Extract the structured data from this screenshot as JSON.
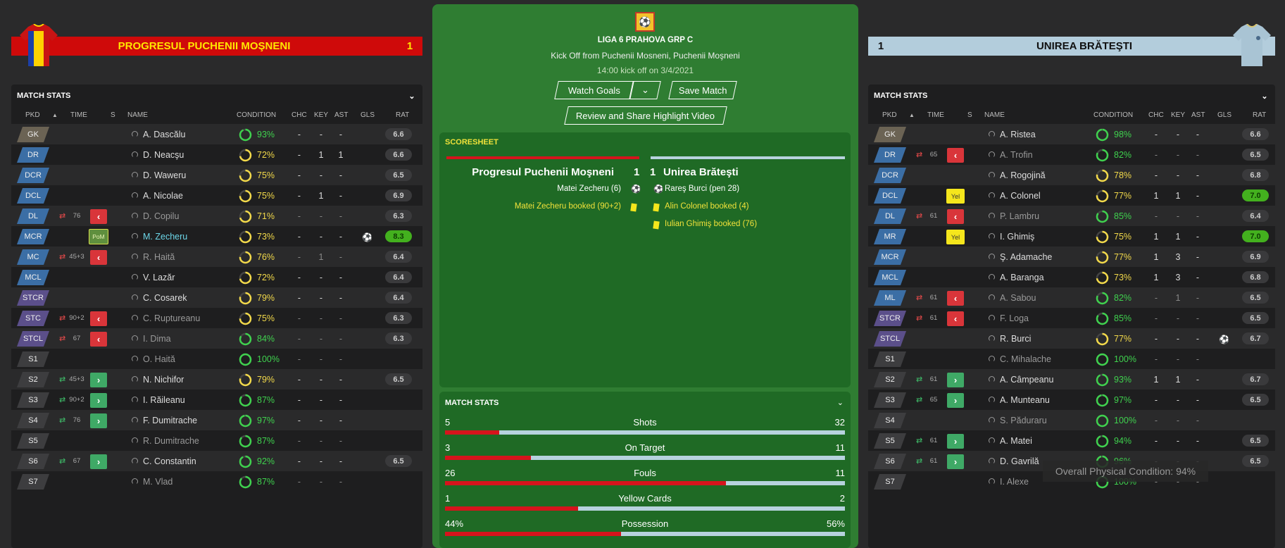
{
  "home": {
    "name": "PROGRESUL PUCHENII MOŞNENI",
    "score": "1",
    "colors": {
      "banner": "#cf0a0a",
      "text": "#ffe600"
    },
    "panel_title": "MATCH STATS",
    "headers": {
      "pkd": "PKD",
      "time": "TIME",
      "s": "S",
      "name": "NAME",
      "condition": "CONDITION",
      "chc": "CHC",
      "key": "KEY",
      "ast": "AST",
      "gls": "GLS",
      "rat": "RAT"
    },
    "players": [
      {
        "pos": "GK",
        "pos_type": "gk",
        "name": "A. Dascălu",
        "cond": "93%",
        "cond_level": 0.93,
        "chc": "-",
        "key": "-",
        "ast": "-",
        "gls": "",
        "rat": "6.6"
      },
      {
        "pos": "DR",
        "pos_type": "def",
        "name": "D. Neacşu",
        "cond": "72%",
        "cond_level": 0.72,
        "chc": "-",
        "key": "1",
        "ast": "1",
        "gls": "",
        "rat": "6.6"
      },
      {
        "pos": "DCR",
        "pos_type": "def",
        "name": "D. Waweru",
        "cond": "75%",
        "cond_level": 0.75,
        "chc": "-",
        "key": "-",
        "ast": "-",
        "gls": "",
        "rat": "6.5"
      },
      {
        "pos": "DCL",
        "pos_type": "def",
        "name": "A. Nicolae",
        "cond": "75%",
        "cond_level": 0.75,
        "chc": "-",
        "key": "1",
        "ast": "-",
        "gls": "",
        "rat": "6.9"
      },
      {
        "pos": "DL",
        "pos_type": "def",
        "swap": "out",
        "time": "76",
        "arrow": "out",
        "name": "D. Copilu",
        "dim": true,
        "cond": "71%",
        "cond_level": 0.71,
        "chc": "-",
        "key": "-",
        "ast": "-",
        "gls": "",
        "rat": "6.3"
      },
      {
        "pos": "MCR",
        "pos_type": "def",
        "badge": "PoM",
        "name": "M. Zecheru",
        "hl": true,
        "cond": "73%",
        "cond_level": 0.73,
        "chc": "-",
        "key": "-",
        "ast": "-",
        "gls": "ball",
        "rat": "8.3",
        "best": true
      },
      {
        "pos": "MC",
        "pos_type": "def",
        "swap": "out",
        "time": "45+3",
        "arrow": "out",
        "name": "R. Haită",
        "dim": true,
        "cond": "76%",
        "cond_level": 0.76,
        "chc": "-",
        "key": "1",
        "ast": "-",
        "gls": "",
        "rat": "6.4"
      },
      {
        "pos": "MCL",
        "pos_type": "def",
        "name": "V. Lazăr",
        "cond": "72%",
        "cond_level": 0.72,
        "chc": "-",
        "key": "-",
        "ast": "-",
        "gls": "",
        "rat": "6.4"
      },
      {
        "pos": "STCR",
        "pos_type": "fw",
        "name": "C. Cosarek",
        "cond": "79%",
        "cond_level": 0.79,
        "chc": "-",
        "key": "-",
        "ast": "-",
        "gls": "",
        "rat": "6.4"
      },
      {
        "pos": "STC",
        "pos_type": "fw",
        "swap": "out",
        "time": "90+2",
        "arrow": "out",
        "name": "C. Ruptureanu",
        "dim": true,
        "cond": "75%",
        "cond_level": 0.75,
        "chc": "-",
        "key": "-",
        "ast": "-",
        "gls": "",
        "rat": "6.3"
      },
      {
        "pos": "STCL",
        "pos_type": "fw",
        "swap": "out",
        "time": "67",
        "arrow": "out",
        "name": "I. Dima",
        "dim": true,
        "cond": "84%",
        "cond_level": 0.84,
        "chc": "-",
        "key": "-",
        "ast": "-",
        "gls": "",
        "rat": "6.3"
      },
      {
        "pos": "S1",
        "pos_type": "sub",
        "name": "O. Haită",
        "dim": true,
        "cond": "100%",
        "cond_level": 1.0,
        "chc": "-",
        "key": "-",
        "ast": "-",
        "gls": "",
        "rat": ""
      },
      {
        "pos": "S2",
        "pos_type": "sub",
        "swap": "in",
        "time": "45+3",
        "arrow": "in",
        "name": "N. Nichifor",
        "cond": "79%",
        "cond_level": 0.79,
        "chc": "-",
        "key": "-",
        "ast": "-",
        "gls": "",
        "rat": "6.5"
      },
      {
        "pos": "S3",
        "pos_type": "sub",
        "swap": "in",
        "time": "90+2",
        "arrow": "in",
        "name": "I. Răileanu",
        "cond": "87%",
        "cond_level": 0.87,
        "chc": "-",
        "key": "-",
        "ast": "-",
        "gls": "",
        "rat": ""
      },
      {
        "pos": "S4",
        "pos_type": "sub",
        "swap": "in",
        "time": "76",
        "arrow": "in",
        "name": "F. Dumitrache",
        "cond": "97%",
        "cond_level": 0.97,
        "chc": "-",
        "key": "-",
        "ast": "-",
        "gls": "",
        "rat": ""
      },
      {
        "pos": "S5",
        "pos_type": "sub",
        "name": "R. Dumitrache",
        "dim": true,
        "cond": "87%",
        "cond_level": 0.87,
        "chc": "-",
        "key": "-",
        "ast": "-",
        "gls": "",
        "rat": ""
      },
      {
        "pos": "S6",
        "pos_type": "sub",
        "swap": "in",
        "time": "67",
        "arrow": "in",
        "name": "C. Constantin",
        "cond": "92%",
        "cond_level": 0.92,
        "chc": "-",
        "key": "-",
        "ast": "-",
        "gls": "",
        "rat": "6.5"
      },
      {
        "pos": "S7",
        "pos_type": "sub",
        "name": "M. Vlad",
        "dim": true,
        "cond": "87%",
        "cond_level": 0.87,
        "chc": "-",
        "key": "-",
        "ast": "-",
        "gls": "",
        "rat": ""
      }
    ]
  },
  "away": {
    "name": "UNIREA BRĂTEŞTI",
    "score": "1",
    "colors": {
      "banner": "#b3cddc",
      "text": "#111111"
    },
    "panel_title": "MATCH STATS",
    "headers": {
      "pkd": "PKD",
      "time": "TIME",
      "s": "S",
      "name": "NAME",
      "condition": "CONDITION",
      "chc": "CHC",
      "key": "KEY",
      "ast": "AST",
      "gls": "GLS",
      "rat": "RAT"
    },
    "players": [
      {
        "pos": "GK",
        "pos_type": "gk",
        "name": "A. Ristea",
        "cond": "98%",
        "cond_level": 0.98,
        "chc": "-",
        "key": "-",
        "ast": "-",
        "gls": "",
        "rat": "6.6"
      },
      {
        "pos": "DR",
        "pos_type": "def",
        "swap": "out",
        "time": "65",
        "arrow": "out",
        "name": "A. Trofin",
        "dim": true,
        "cond": "82%",
        "cond_level": 0.82,
        "chc": "-",
        "key": "-",
        "ast": "-",
        "gls": "",
        "rat": "6.5"
      },
      {
        "pos": "DCR",
        "pos_type": "def",
        "name": "A. Rogojină",
        "cond": "78%",
        "cond_level": 0.78,
        "chc": "-",
        "key": "-",
        "ast": "-",
        "gls": "",
        "rat": "6.8"
      },
      {
        "pos": "DCL",
        "pos_type": "def",
        "badge": "Yel",
        "name": "A. Colonel",
        "cond": "77%",
        "cond_level": 0.77,
        "chc": "1",
        "key": "1",
        "ast": "-",
        "gls": "",
        "rat": "7.0",
        "best": true
      },
      {
        "pos": "DL",
        "pos_type": "def",
        "swap": "out",
        "time": "61",
        "arrow": "out",
        "name": "P. Lambru",
        "dim": true,
        "cond": "85%",
        "cond_level": 0.85,
        "chc": "-",
        "key": "-",
        "ast": "-",
        "gls": "",
        "rat": "6.4"
      },
      {
        "pos": "MR",
        "pos_type": "def",
        "badge": "Yel",
        "name": "I. Ghimiş",
        "cond": "75%",
        "cond_level": 0.75,
        "chc": "1",
        "key": "1",
        "ast": "-",
        "gls": "",
        "rat": "7.0",
        "best": true
      },
      {
        "pos": "MCR",
        "pos_type": "def",
        "name": "Ş. Adamache",
        "cond": "77%",
        "cond_level": 0.77,
        "chc": "1",
        "key": "3",
        "ast": "-",
        "gls": "",
        "rat": "6.9"
      },
      {
        "pos": "MCL",
        "pos_type": "def",
        "name": "A. Baranga",
        "cond": "73%",
        "cond_level": 0.73,
        "chc": "1",
        "key": "3",
        "ast": "-",
        "gls": "",
        "rat": "6.8"
      },
      {
        "pos": "ML",
        "pos_type": "def",
        "swap": "out",
        "time": "61",
        "arrow": "out",
        "name": "A. Sabou",
        "dim": true,
        "cond": "82%",
        "cond_level": 0.82,
        "chc": "-",
        "key": "1",
        "ast": "-",
        "gls": "",
        "rat": "6.5"
      },
      {
        "pos": "STCR",
        "pos_type": "fw",
        "swap": "out",
        "time": "61",
        "arrow": "out",
        "name": "F. Loga",
        "dim": true,
        "cond": "85%",
        "cond_level": 0.85,
        "chc": "-",
        "key": "-",
        "ast": "-",
        "gls": "",
        "rat": "6.5"
      },
      {
        "pos": "STCL",
        "pos_type": "fw",
        "name": "R. Burci",
        "cond": "77%",
        "cond_level": 0.77,
        "chc": "-",
        "key": "-",
        "ast": "-",
        "gls": "ball",
        "rat": "6.7"
      },
      {
        "pos": "S1",
        "pos_type": "sub",
        "name": "C. Mihalache",
        "dim": true,
        "cond": "100%",
        "cond_level": 1.0,
        "chc": "-",
        "key": "-",
        "ast": "-",
        "gls": "",
        "rat": ""
      },
      {
        "pos": "S2",
        "pos_type": "sub",
        "swap": "in",
        "time": "61",
        "arrow": "in",
        "name": "A. Câmpeanu",
        "cond": "93%",
        "cond_level": 0.93,
        "chc": "1",
        "key": "1",
        "ast": "-",
        "gls": "",
        "rat": "6.7"
      },
      {
        "pos": "S3",
        "pos_type": "sub",
        "swap": "in",
        "time": "65",
        "arrow": "in",
        "name": "A. Munteanu",
        "cond": "97%",
        "cond_level": 0.97,
        "chc": "-",
        "key": "-",
        "ast": "-",
        "gls": "",
        "rat": "6.5"
      },
      {
        "pos": "S4",
        "pos_type": "sub",
        "name": "S. Păduraru",
        "dim": true,
        "cond": "100%",
        "cond_level": 1.0,
        "chc": "-",
        "key": "-",
        "ast": "-",
        "gls": "",
        "rat": ""
      },
      {
        "pos": "S5",
        "pos_type": "sub",
        "swap": "in",
        "time": "61",
        "arrow": "in",
        "name": "A. Matei",
        "cond": "94%",
        "cond_level": 0.94,
        "chc": "-",
        "key": "-",
        "ast": "-",
        "gls": "",
        "rat": "6.5"
      },
      {
        "pos": "S6",
        "pos_type": "sub",
        "swap": "in",
        "time": "61",
        "arrow": "in",
        "name": "D. Gavrilă",
        "cond": "96%",
        "cond_level": 0.96,
        "chc": "-",
        "key": "-",
        "ast": "-",
        "gls": "",
        "rat": "6.5"
      },
      {
        "pos": "S7",
        "pos_type": "sub",
        "name": "I. Alexe",
        "dim": true,
        "cond": "100%",
        "cond_level": 1.0,
        "chc": "-",
        "key": "-",
        "ast": "-",
        "gls": "",
        "rat": ""
      }
    ]
  },
  "match": {
    "competition": "LIGA 6 PRAHOVA GRP C",
    "kickoff_venue": "Kick Off from Puchenii Mosneni, Puchenii Moşneni",
    "kickoff_time": "14:00 kick off on 3/4/2021",
    "buttons": {
      "watch_goals": "Watch Goals",
      "save_match": "Save Match",
      "review": "Review and Share Highlight Video"
    },
    "scoresheet": {
      "title": "SCORESHEET",
      "home_team": "Progresul Puchenii Moşneni",
      "home_score": "1",
      "away_score": "1",
      "away_team": "Unirea Brăteşti",
      "home_events": [
        {
          "text": "Matei Zecheru (6)",
          "type": "goal"
        },
        {
          "text": "Matei Zecheru booked (90+2)",
          "type": "yellow"
        }
      ],
      "away_events": [
        {
          "text": "Rareş Burci (pen 28)",
          "type": "goal"
        },
        {
          "text": "Alin Colonel booked (4)",
          "type": "yellow"
        },
        {
          "text": "Iulian Ghimiş booked (76)",
          "type": "yellow"
        }
      ]
    },
    "stats": {
      "title": "MATCH STATS",
      "rows": [
        {
          "home": "5",
          "label": "Shots",
          "away": "32",
          "home_share": 0.135
        },
        {
          "home": "3",
          "label": "On Target",
          "away": "11",
          "home_share": 0.214
        },
        {
          "home": "26",
          "label": "Fouls",
          "away": "11",
          "home_share": 0.703
        },
        {
          "home": "1",
          "label": "Yellow Cards",
          "away": "2",
          "home_share": 0.333
        },
        {
          "home": "44%",
          "label": "Possession",
          "away": "56%",
          "home_share": 0.44
        }
      ]
    }
  },
  "tooltip": "Overall Physical Condition: 94%",
  "colors": {
    "pitch": "#2f7d32",
    "home_bar": "#d6141c",
    "away_bar": "#b7d2de",
    "cond_green": "#3fd14e",
    "cond_yellow": "#f2d94a"
  }
}
